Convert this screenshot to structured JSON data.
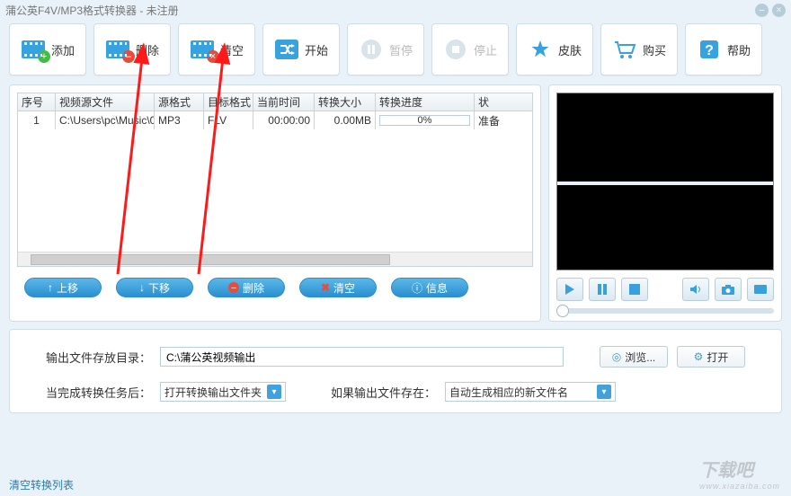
{
  "window": {
    "title": "蒲公英F4V/MP3格式转换器 - 未注册"
  },
  "toolbar": [
    {
      "key": "add",
      "label": "添加",
      "disabled": false
    },
    {
      "key": "delete",
      "label": "删除",
      "disabled": false
    },
    {
      "key": "clear",
      "label": "清空",
      "disabled": false
    },
    {
      "key": "start",
      "label": "开始",
      "disabled": false
    },
    {
      "key": "pause",
      "label": "暂停",
      "disabled": true
    },
    {
      "key": "stop",
      "label": "停止",
      "disabled": true
    },
    {
      "key": "skin",
      "label": "皮肤",
      "disabled": false
    },
    {
      "key": "buy",
      "label": "购买",
      "disabled": false
    },
    {
      "key": "help",
      "label": "帮助",
      "disabled": false
    }
  ],
  "table": {
    "headers": [
      "序号",
      "视频源文件",
      "源格式",
      "目标格式",
      "当前时间",
      "转换大小",
      "转换进度",
      "状"
    ],
    "rows": [
      {
        "index": "1",
        "source": "C:\\Users\\pc\\Music\\0...",
        "srcFmt": "MP3",
        "dstFmt": "FLV",
        "time": "00:00:00",
        "size": "0.00MB",
        "progress": "0%",
        "status": "准备"
      }
    ]
  },
  "actions": {
    "moveUp": "上移",
    "moveDown": "下移",
    "delete": "删除",
    "clear": "清空",
    "info": "信息"
  },
  "media": {
    "play": "play-icon",
    "pause": "pause-icon",
    "stop": "stop-icon",
    "mute": "mute-icon",
    "snapshot": "snapshot-icon",
    "fullscreen": "fullscreen-icon"
  },
  "output": {
    "dirLabel": "输出文件存放目录：",
    "dirValue": "C:\\蒲公英视频输出",
    "browse": "浏览...",
    "open": "打开",
    "afterLabel": "当完成转换任务后：",
    "afterValue": "打开转换输出文件夹",
    "existsLabel": "如果输出文件存在：",
    "existsValue": "自动生成相应的新文件名"
  },
  "footer": {
    "clearList": "清空转换列表"
  },
  "watermark": {
    "line1": "下载吧",
    "line2": "www.xiazaiba.com"
  }
}
